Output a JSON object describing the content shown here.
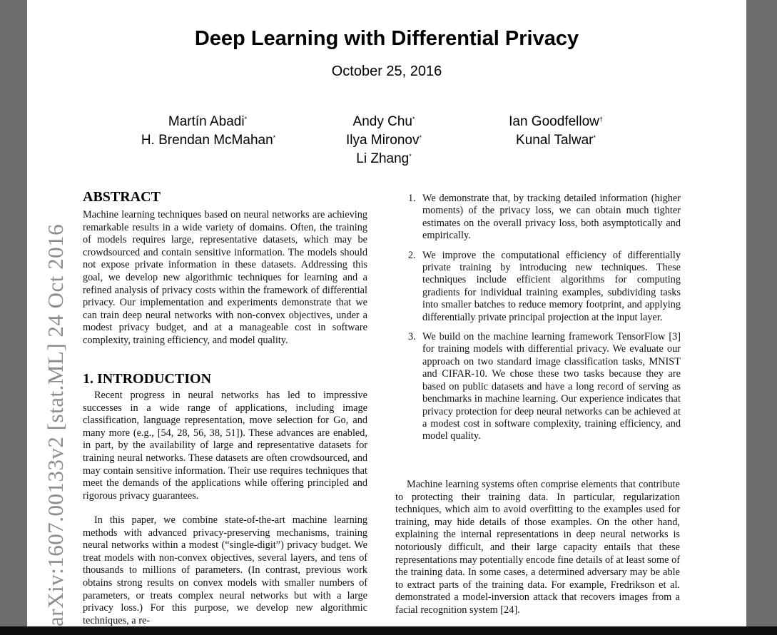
{
  "paper": {
    "title": "Deep Learning with Differential Privacy",
    "date": "October 25, 2016",
    "authors": [
      {
        "name": "Martín Abadi",
        "mark": "*"
      },
      {
        "name": "Andy Chu",
        "mark": "*"
      },
      {
        "name": "Ian Goodfellow",
        "mark": "†"
      },
      {
        "name": "H. Brendan McMahan",
        "mark": "*"
      },
      {
        "name": "Ilya Mironov",
        "mark": "*"
      },
      {
        "name": "Kunal Talwar",
        "mark": "*"
      },
      {
        "name": "Li Zhang",
        "mark": "*"
      }
    ],
    "arxiv_stamp": "arXiv:1607.00133v2  [stat.ML]  24 Oct 2016",
    "abstract": {
      "heading": "ABSTRACT",
      "text": "Machine learning techniques based on neural networks are achieving remarkable results in a wide variety of domains. Often, the training of models requires large, representative datasets, which may be crowdsourced and contain sensitive information. The models should not expose private information in these datasets. Addressing this goal, we develop new algorithmic techniques for learning and a refined analysis of privacy costs within the framework of differential privacy. Our implementation and experiments demonstrate that we can train deep neural networks with non-convex objectives, under a modest privacy budget, and at a manageable cost in software complexity, training efficiency, and model quality."
    },
    "introduction": {
      "heading": "1.  INTRODUCTION",
      "para1": "Recent progress in neural networks has led to impressive successes in a wide range of applications, including image classification, language representation, move selection for Go, and many more (e.g., [54, 28, 56, 38, 51]). These advances are enabled, in part, by the availability of large and representative datasets for training neural networks. These datasets are often crowdsourced, and may contain sensitive information. Their use requires techniques that meet the demands of the applications while offering principled and rigorous privacy guarantees.",
      "para2": "In this paper, we combine state-of-the-art machine learning methods with advanced privacy-preserving mechanisms, training neural networks within a modest (“single-digit”) privacy budget. We treat models with non-convex objectives, several layers, and tens of thousands to millions of parameters. (In contrast, previous work obtains strong results on convex models with smaller numbers of parameters, or treats complex neural networks but with a large privacy loss.) For this purpose, we develop new algorithmic techniques, a re-"
    },
    "contributions": [
      {
        "num": "1.",
        "text": "We demonstrate that, by tracking detailed information (higher moments) of the privacy loss, we can obtain much tighter estimates on the overall privacy loss, both asymptotically and empirically."
      },
      {
        "num": "2.",
        "text": "We improve the computational efficiency of differentially private training by introducing new techniques. These techniques include efficient algorithms for computing gradients for individual training examples, subdividing tasks into smaller batches to reduce memory footprint, and applying differentially private principal projection at the input layer."
      },
      {
        "num": "3.",
        "text": "We build on the machine learning framework TensorFlow [3] for training models with differential privacy. We evaluate our approach on two standard image classification tasks, MNIST and CIFAR-10. We chose these two tasks because they are based on public datasets and have a long record of serving as benchmarks in machine learning. Our experience indicates that privacy protection for deep neural networks can be achieved at a modest cost in software complexity, training efficiency, and model quality."
      }
    ],
    "right_para": "Machine learning systems often comprise elements that contribute to protecting their training data. In particular, regularization techniques, which aim to avoid overfitting to the examples used for training, may hide details of those examples. On the other hand, explaining the internal representations in deep neural networks is notoriously difficult, and their large capacity entails that these representations may potentially encode fine details of at least some of the training data. In some cases, a determined adversary may be able to extract parts of the training data. For example, Fredrikson et al. demonstrated a model-inversion attack that recovers images from a facial recognition system [24]."
  }
}
